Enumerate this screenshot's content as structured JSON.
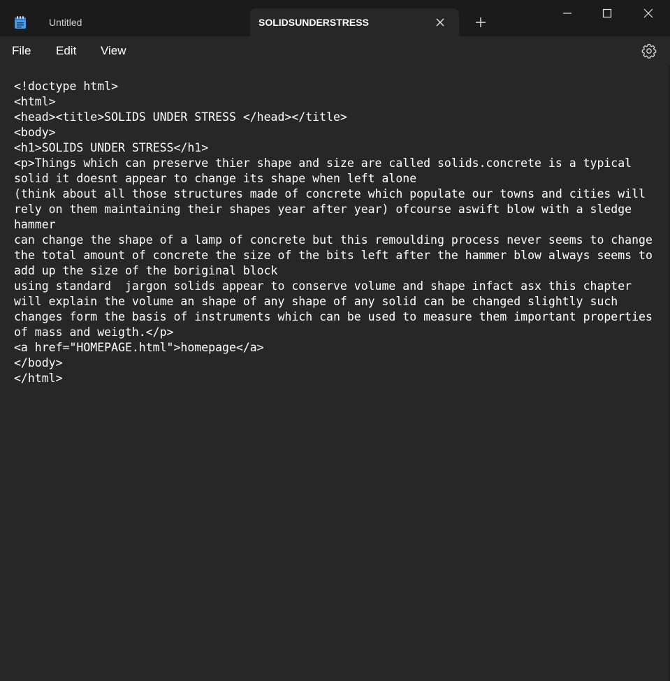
{
  "tabs": [
    {
      "label": "Untitled"
    },
    {
      "label": "SOLIDSUNDERSTRESS",
      "active": true
    }
  ],
  "menu": {
    "file": "File",
    "edit": "Edit",
    "view": "View"
  },
  "icons": {
    "app": "notepad-icon",
    "close_tab": "close-icon",
    "new_tab": "plus-icon",
    "minimize": "minimize-icon",
    "maximize": "maximize-icon",
    "close_window": "close-icon",
    "settings": "gear-icon"
  },
  "colors": {
    "titlebar": "#1b1b1b",
    "editor_bg": "#272727",
    "text": "#ffffff",
    "icon_blue": "#4a9be8"
  },
  "document": {
    "lines": [
      "<!doctype html>",
      "<html>",
      "<head><title>SOLIDS UNDER STRESS </head></title>",
      "<body>",
      "<h1>SOLIDS UNDER STRESS</h1>",
      "<p>Things which can preserve thier shape and size are called solids.concrete is a typical",
      "solid it doesnt appear to change its shape when left alone",
      "(think about all those structures made of concrete which populate our towns and cities will",
      "rely on them maintaining their shapes year after year) ofcourse aswift blow with a sledge",
      "hammer",
      "can change the shape of a lamp of concrete but this remoulding process never seems to change",
      "the total amount of concrete the size of the bits left after the hammer blow always seems to",
      "add up the size of the boriginal block",
      "using standard  jargon solids appear to conserve volume and shape infact asx this chapter",
      "will explain the volume an shape of any shape of any solid can be changed slightly such",
      "changes form the basis of instruments which can be used to measure them important properties",
      "of mass and weigth.</p>",
      "<a href=\"HOMEPAGE.html\">homepage</a>",
      "</body>",
      "</html>"
    ]
  }
}
